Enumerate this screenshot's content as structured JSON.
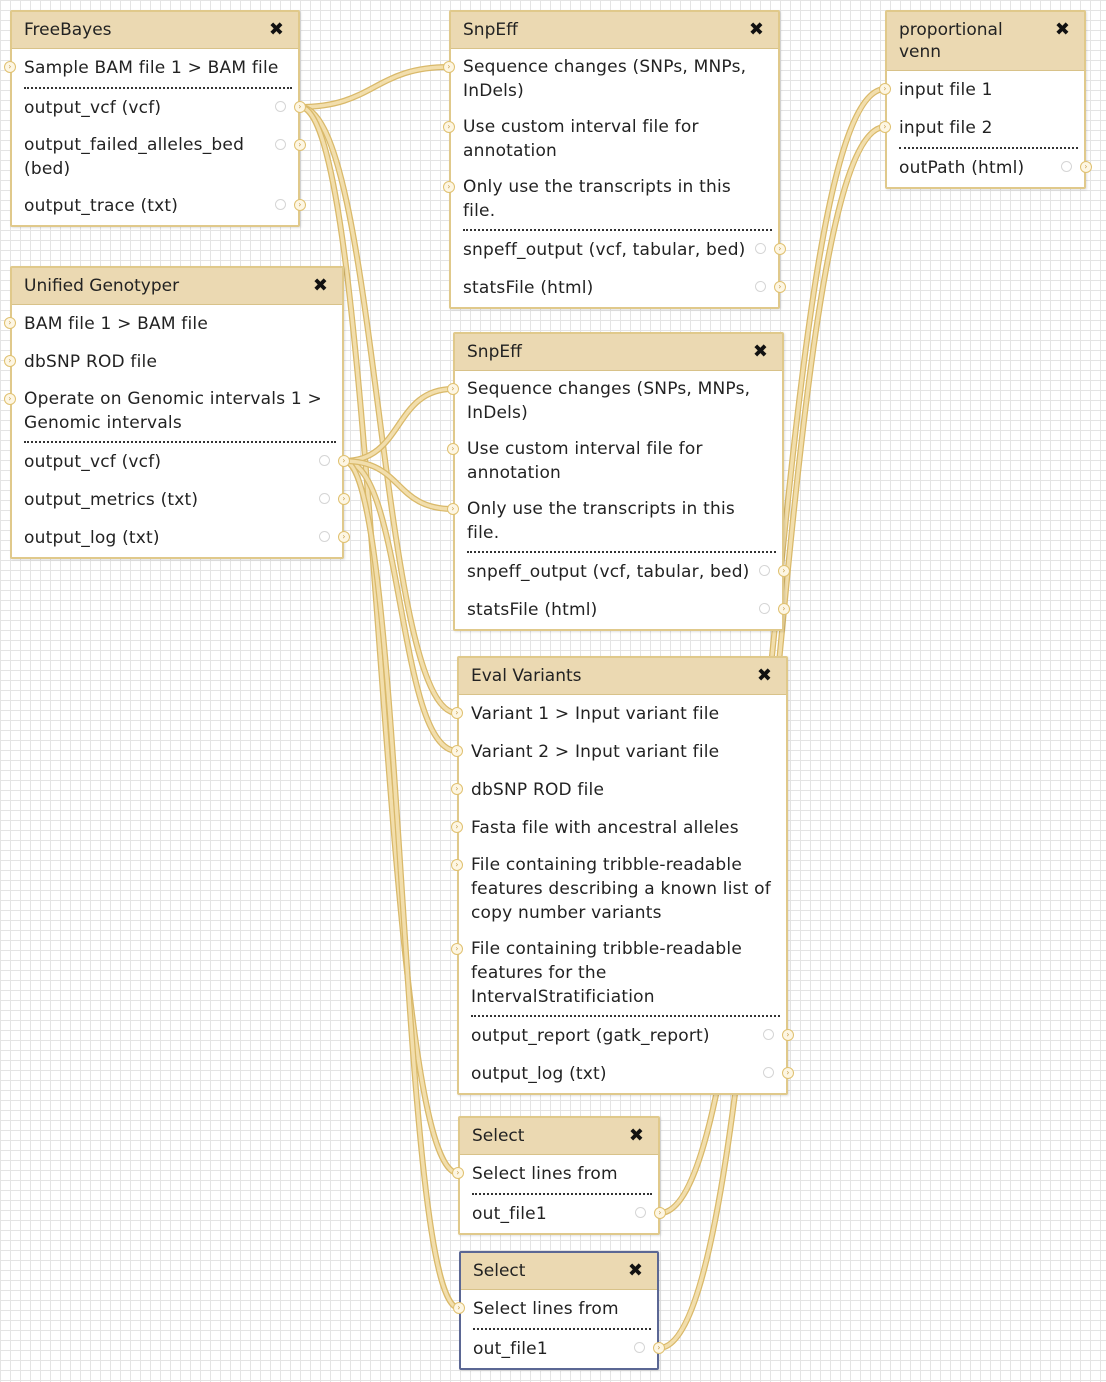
{
  "colors": {
    "wire": "#f2deac",
    "wire_edge": "#d9b96a",
    "node_border": "#e0c98b",
    "node_header": "#ebd9b2",
    "selected_border": "#5b6794"
  },
  "nodes": [
    {
      "id": "freebayes",
      "title": "FreeBayes",
      "close_icon": "✖",
      "inputs": [
        "Sample BAM file 1 > BAM file"
      ],
      "outputs": [
        "output_vcf (vcf)",
        "output_failed_alleles_bed\n(bed)",
        "output_trace (txt)"
      ]
    },
    {
      "id": "snpeff-1",
      "title": "SnpEff",
      "close_icon": "✖",
      "inputs": [
        "Sequence changes (SNPs, MNPs,\nInDels)",
        "Use custom interval file for\nannotation",
        "Only use the transcripts in this\nfile."
      ],
      "outputs": [
        "snpeff_output (vcf, tabular, bed)",
        "statsFile (html)"
      ]
    },
    {
      "id": "proportional-venn",
      "title": "proportional\nvenn",
      "close_icon": "✖",
      "inputs": [
        "input file 1",
        "input file 2"
      ],
      "outputs": [
        "outPath (html)"
      ]
    },
    {
      "id": "unified-genotyper",
      "title": "Unified Genotyper",
      "close_icon": "✖",
      "inputs": [
        "BAM file 1 > BAM file",
        "dbSNP ROD file",
        "Operate on Genomic intervals 1 >\nGenomic intervals"
      ],
      "outputs": [
        "output_vcf (vcf)",
        "output_metrics (txt)",
        "output_log (txt)"
      ]
    },
    {
      "id": "snpeff-2",
      "title": "SnpEff",
      "close_icon": "✖",
      "inputs": [
        "Sequence changes (SNPs, MNPs,\nInDels)",
        "Use custom interval file for\nannotation",
        "Only use the transcripts in this\nfile."
      ],
      "outputs": [
        "snpeff_output (vcf, tabular, bed)",
        "statsFile (html)"
      ]
    },
    {
      "id": "eval-variants",
      "title": "Eval Variants",
      "close_icon": "✖",
      "inputs": [
        "Variant 1 > Input variant file",
        "Variant 2 > Input variant file",
        "dbSNP ROD file",
        "Fasta file with ancestral alleles",
        "File containing tribble-readable\nfeatures describing a known list of\ncopy number variants",
        "File containing tribble-readable\nfeatures for the\nIntervalStratificiation"
      ],
      "outputs": [
        "output_report (gatk_report)",
        "output_log (txt)"
      ]
    },
    {
      "id": "select-1",
      "title": "Select",
      "close_icon": "✖",
      "inputs": [
        "Select lines from"
      ],
      "outputs": [
        "out_file1"
      ]
    },
    {
      "id": "select-2",
      "title": "Select",
      "close_icon": "✖",
      "inputs": [
        "Select lines from"
      ],
      "outputs": [
        "out_file1"
      ]
    }
  ],
  "connections": [
    {
      "from": [
        "freebayes",
        0
      ],
      "to": [
        "snpeff-1",
        0
      ]
    },
    {
      "from": [
        "freebayes",
        0
      ],
      "to": [
        "eval-variants",
        0
      ]
    },
    {
      "from": [
        "freebayes",
        0
      ],
      "to": [
        "select-1",
        0
      ]
    },
    {
      "from": [
        "unified-genotyper",
        0
      ],
      "to": [
        "snpeff-2",
        0
      ]
    },
    {
      "from": [
        "unified-genotyper",
        0
      ],
      "to": [
        "eval-variants",
        1
      ]
    },
    {
      "from": [
        "unified-genotyper",
        0
      ],
      "to": [
        "select-2",
        0
      ]
    },
    {
      "from": [
        "unified-genotyper",
        0
      ],
      "to": [
        "snpeff-2",
        2
      ]
    },
    {
      "from": [
        "select-1",
        0
      ],
      "to": [
        "proportional-venn",
        0
      ]
    },
    {
      "from": [
        "select-2",
        0
      ],
      "to": [
        "proportional-venn",
        1
      ]
    }
  ]
}
